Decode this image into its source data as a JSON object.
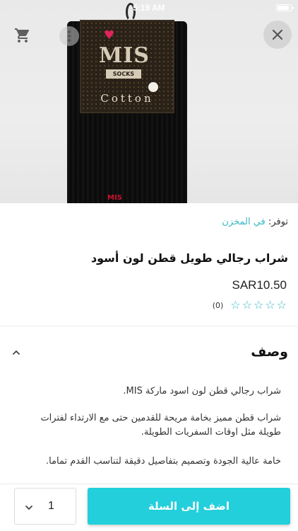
{
  "status_bar": {
    "time": "5:19 AM"
  },
  "product_image": {
    "brand_logo": "MIS",
    "brand_sub": "SOCKS",
    "material_band": "Cotton",
    "bottom_logo": "MIS"
  },
  "icons": {
    "cart": "cart-icon",
    "more": "more-vertical-icon",
    "close": "close-icon",
    "chevron_up": "chevron-up-icon",
    "chevron_down": "chevron-down-icon",
    "star": "star-outline-icon"
  },
  "availability": {
    "label": "توفر:",
    "value": "في المخزن"
  },
  "product": {
    "title": "شراب رجالي طويل قطن لون أسود",
    "price": "SAR10.50",
    "rating_count": "(0)",
    "rating_value": 0,
    "rating_max": 5
  },
  "description": {
    "heading": "وصف",
    "paragraphs": [
      "شراب رجالي قطن لون اسود ماركة MIS.",
      "شراب قطن مميز بخامة مريحة للقدمين حتى مع الارتداء لفترات طويلة مثل اوقات السفريات الطويلة.",
      "خامة عالية الجودة وتصميم بتفاصيل دقيقة لتناسب القدم تماما."
    ]
  },
  "purchase": {
    "quantity": "1",
    "add_to_cart_label": "اضف إلى السلة"
  },
  "colors": {
    "accent": "#39b9c3",
    "button": "#22cfdb"
  }
}
